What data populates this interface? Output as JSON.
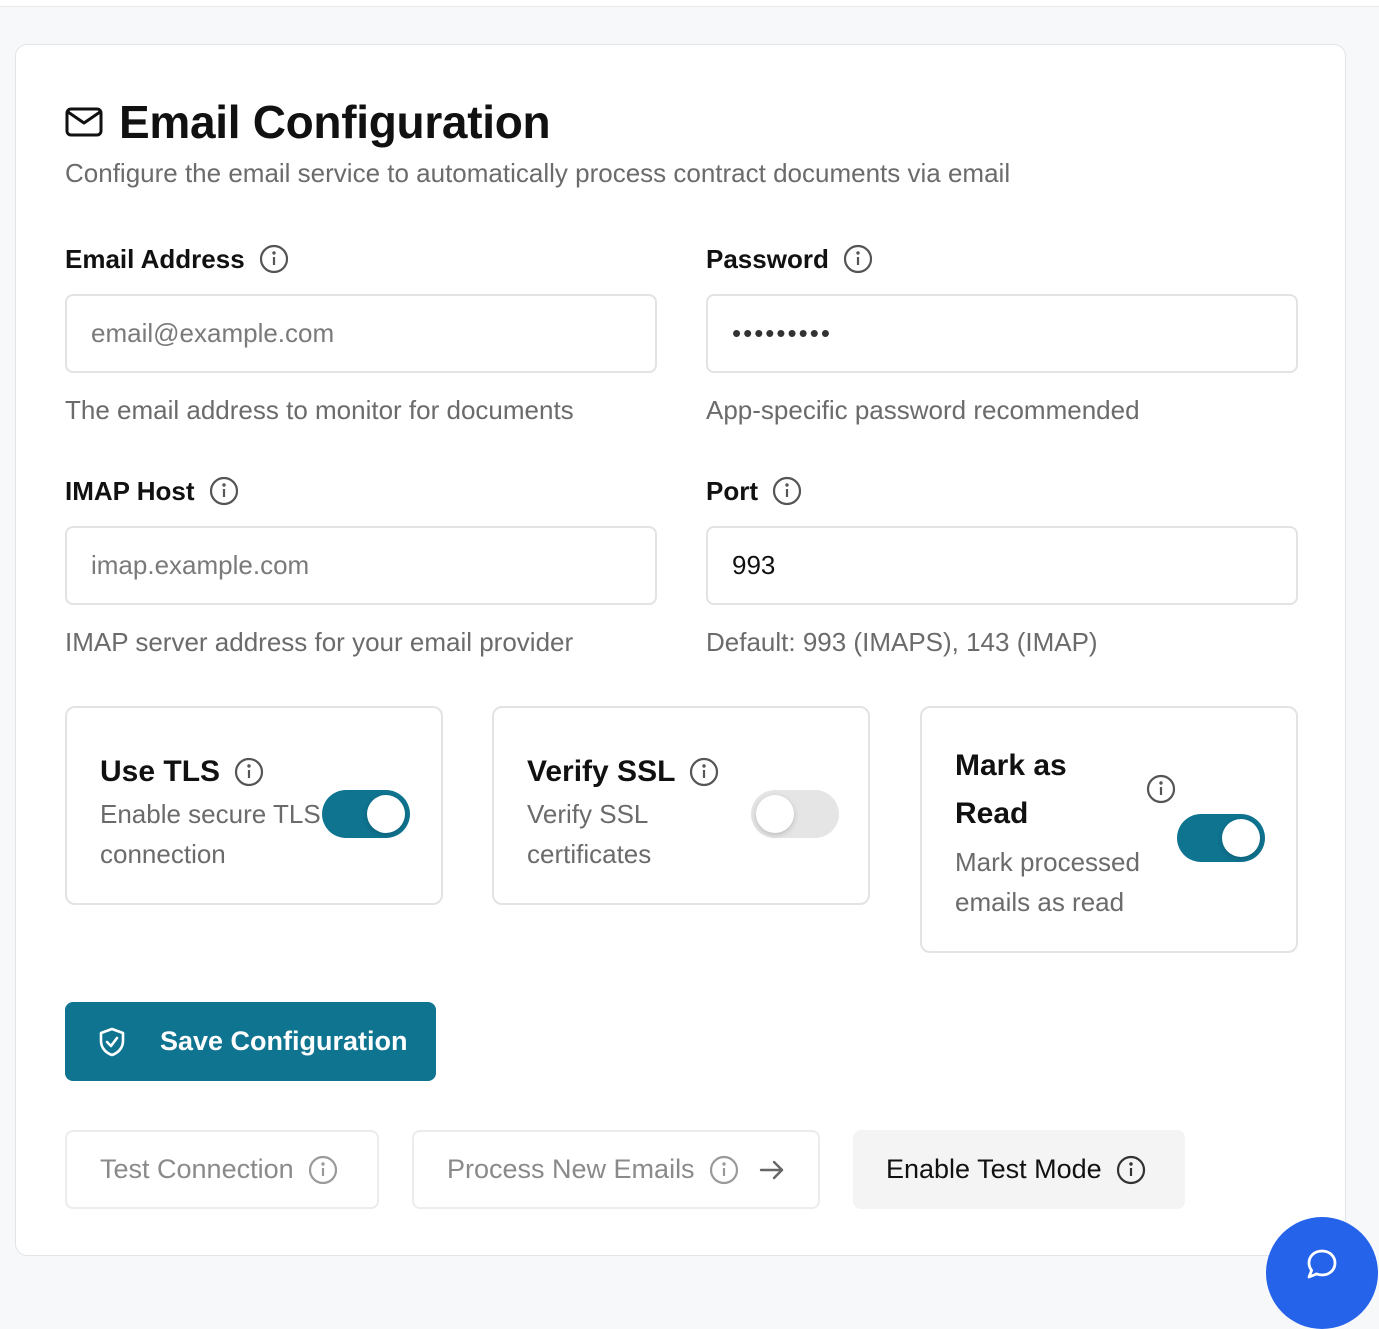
{
  "header": {
    "title": "Email Configuration",
    "subtitle": "Configure the email service to automatically process contract documents via email",
    "icon": "mail-icon"
  },
  "fields": {
    "email": {
      "label": "Email Address",
      "placeholder": "email@example.com",
      "value": "",
      "help": "The email address to monitor for documents"
    },
    "password": {
      "label": "Password",
      "value": "•••••••••",
      "help": "App-specific password recommended"
    },
    "imap_host": {
      "label": "IMAP Host",
      "placeholder": "imap.example.com",
      "value": "",
      "help": "IMAP server address for your email provider"
    },
    "port": {
      "label": "Port",
      "value": "993",
      "help": "Default: 993 (IMAPS), 143 (IMAP)"
    }
  },
  "toggles": {
    "tls": {
      "title": "Use TLS",
      "desc_line1": "Enable secure TLS",
      "desc_line2": "connection",
      "enabled": true
    },
    "ssl": {
      "title": "Verify SSL",
      "desc_line1": "Verify SSL",
      "desc_line2": "certificates",
      "enabled": false
    },
    "mark_read": {
      "title_line1": "Mark as",
      "title_line2": "Read",
      "desc_line1": "Mark processed",
      "desc_line2": "emails as read",
      "enabled": true
    }
  },
  "actions": {
    "save_label": "Save Configuration",
    "test_connection_label": "Test Connection",
    "process_emails_label": "Process New Emails",
    "test_mode_label": "Enable Test Mode"
  },
  "colors": {
    "primary": "#0f7490",
    "switch_off": "#e5e5e5",
    "soft_button": "#f4f4f4",
    "fab": "#2563eb"
  }
}
